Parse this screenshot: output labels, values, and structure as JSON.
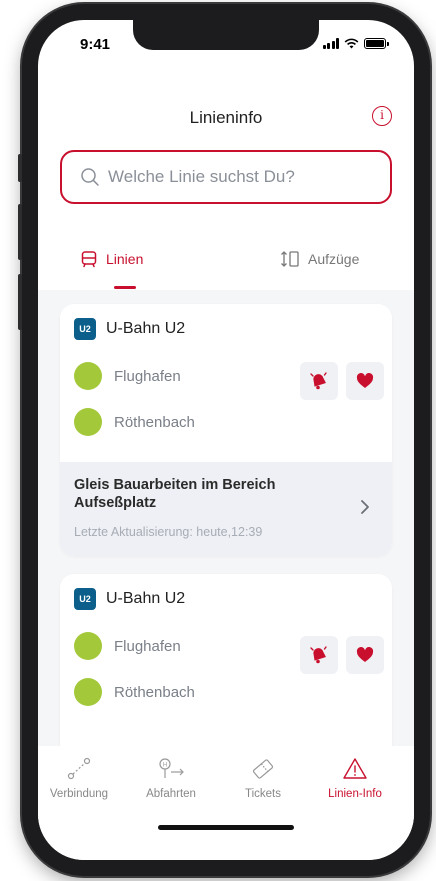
{
  "status": {
    "time": "9:41"
  },
  "header": {
    "title": "Linieninfo",
    "info_label": "i"
  },
  "search": {
    "placeholder": "Welche Linie suchst Du?"
  },
  "tabs": [
    {
      "label": "Linien",
      "icon": "bus-icon",
      "active": true
    },
    {
      "label": "Aufzüge",
      "icon": "elevator-icon",
      "active": false
    }
  ],
  "cards": [
    {
      "badge": "U2",
      "line": "U-Bahn U2",
      "stops": [
        "Flughafen",
        "Röthenbach"
      ],
      "notice": {
        "title": "Gleis Bauarbeiten im Bereich Aufseßplatz",
        "updated": "Letzte Aktualisierung: heute,12:39"
      }
    },
    {
      "badge": "U2",
      "line": "U-Bahn U2",
      "stops": [
        "Flughafen",
        "Röthenbach"
      ]
    }
  ],
  "nav": [
    {
      "label": "Verbindung",
      "icon": "route-icon",
      "active": false
    },
    {
      "label": "Abfahrten",
      "icon": "departures-icon",
      "active": false
    },
    {
      "label": "Tickets",
      "icon": "ticket-icon",
      "active": false
    },
    {
      "label": "Linien-Info",
      "icon": "warning-icon",
      "active": true
    }
  ],
  "colors": {
    "accent": "#c8102e",
    "stop_dot": "#a3c93a",
    "ubahn_badge": "#0b5f8a"
  }
}
